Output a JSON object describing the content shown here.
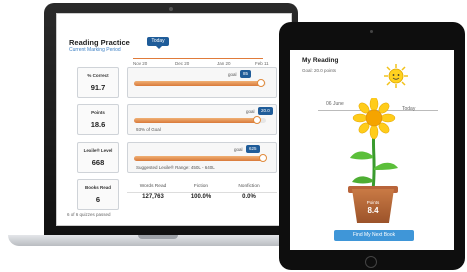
{
  "laptop": {
    "title": "Reading Practice",
    "subtitle": "Current Marking Period",
    "timeline": {
      "today_label": "Today",
      "labels": [
        "Nov 20",
        "Dec 20",
        "Jan 20",
        "Feb 11"
      ]
    },
    "metrics": [
      {
        "label": "% Correct",
        "value": "91.7"
      },
      {
        "label": "Points",
        "value": "18.6"
      },
      {
        "label": "Lexile® Level",
        "value": "668"
      },
      {
        "label": "Books Read",
        "value": "6"
      }
    ],
    "bars": [
      {
        "goal_label": "goal",
        "goal_value": "85",
        "progress": 0.96,
        "caption": ""
      },
      {
        "goal_label": "goal",
        "goal_value": "20.0",
        "progress": 0.93,
        "caption": "93% of Goal"
      },
      {
        "goal_label": "goal",
        "goal_value": "625",
        "progress": 0.98,
        "caption": "Suggested Lexile® Range: 450L - 640L"
      }
    ],
    "books_table": {
      "headers": [
        "Words Read",
        "Fiction",
        "Nonfiction"
      ],
      "values": [
        "127,763",
        "100.0%",
        "0.0%"
      ]
    },
    "quiz_footer": "6 of 6 quizzes passed"
  },
  "tablet": {
    "title": "My Reading",
    "goal": "Goal: 20.0 points",
    "date_start": "06 June",
    "date_end": "Today",
    "points_label": "Points",
    "points_value": "8.4",
    "button_label": "Find My Next Book"
  },
  "colors": {
    "accent_blue": "#1f5c99",
    "bar_orange": "#d9793a",
    "button_blue": "#3f96d8",
    "pot_brown": "#b8643a"
  },
  "icons": [
    "sun-icon",
    "sunflower-plant-icon"
  ]
}
